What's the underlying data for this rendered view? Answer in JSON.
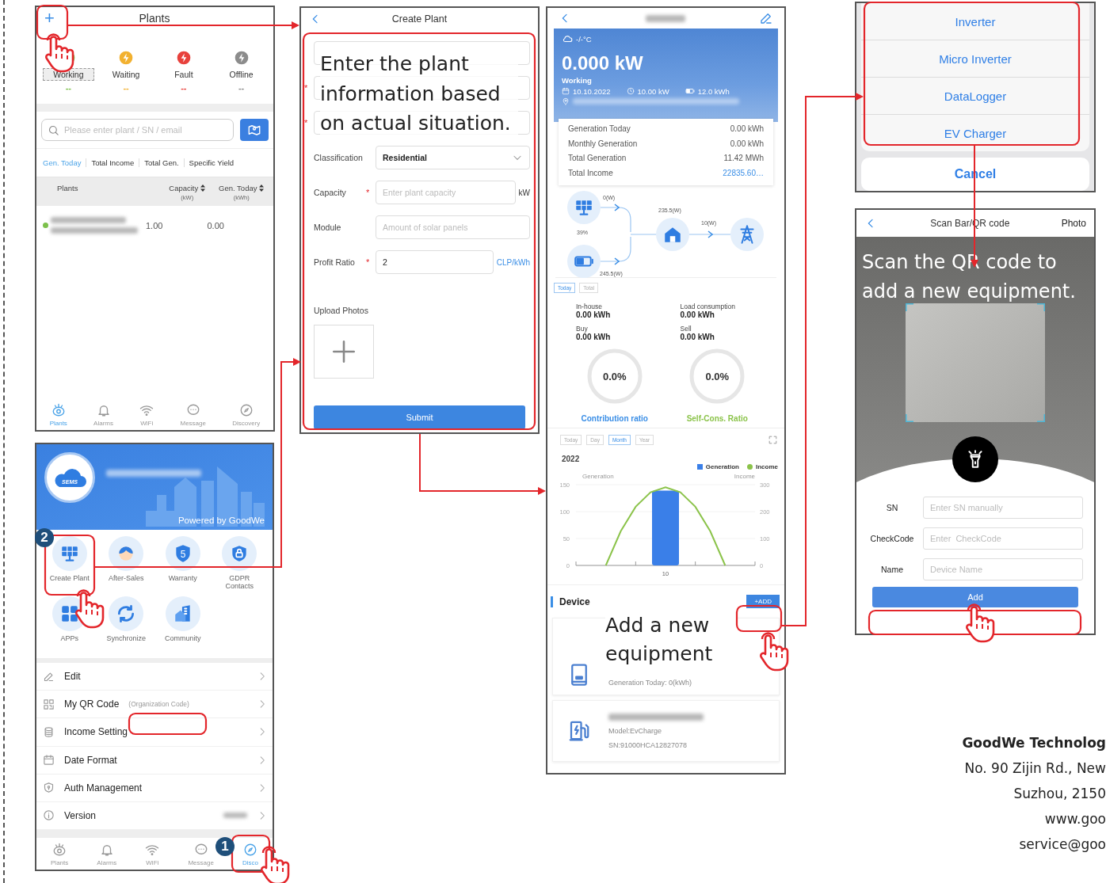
{
  "plants_screen": {
    "add_icon": "+",
    "title": "Plants",
    "status_filters": [
      {
        "label": "Working",
        "count": "--",
        "color": "#7cc04b",
        "selected": true
      },
      {
        "label": "Waiting",
        "count": "--",
        "color": "#f2b130",
        "selected": false
      },
      {
        "label": "Fault",
        "count": "--",
        "color": "#e8413c",
        "selected": false
      },
      {
        "label": "Offline",
        "count": "--",
        "color": "#8c8c8c",
        "selected": false
      }
    ],
    "search": {
      "placeholder": "Please enter plant / SN / email"
    },
    "tabs": [
      {
        "label": "Gen. Today",
        "selected": true
      },
      {
        "label": "Total Income",
        "selected": false
      },
      {
        "label": "Total Gen.",
        "selected": false
      },
      {
        "label": "Specific Yield",
        "selected": false
      }
    ],
    "columns": [
      {
        "label": "Plants"
      },
      {
        "label": "Capacity",
        "unit": "(kW)"
      },
      {
        "label": "Gen. Today",
        "unit": "(kWh)"
      }
    ],
    "rows": [
      {
        "color": "#7cc04b",
        "name_hidden": true,
        "capacity": "1.00",
        "gen_today": "0.00"
      }
    ],
    "nav": [
      {
        "label": "Plants",
        "selected": true
      },
      {
        "label": "Alarms",
        "selected": false
      },
      {
        "label": "WiFi",
        "selected": false
      },
      {
        "label": "Message",
        "selected": false
      },
      {
        "label": "Discovery",
        "selected": false
      }
    ]
  },
  "discovery_screen": {
    "logo_text": "SEMS",
    "email_hidden": true,
    "powered_by": "Powered by GoodWe",
    "services": [
      {
        "label": "Create Plant"
      },
      {
        "label": "After-Sales"
      },
      {
        "label": "Warranty",
        "badge": "5"
      },
      {
        "label": "GDPR Contacts"
      },
      {
        "label": "APPs"
      },
      {
        "label": "Synchronize"
      },
      {
        "label": "Community"
      }
    ],
    "menu": [
      {
        "label": "Edit"
      },
      {
        "label": "My QR Code",
        "note": "(Organization Code)"
      },
      {
        "label": "Income Setting"
      },
      {
        "label": "Date Format"
      },
      {
        "label": "Auth Management"
      },
      {
        "label": "Version",
        "value_hidden": true
      }
    ],
    "nav": [
      {
        "label": "Plants",
        "selected": false
      },
      {
        "label": "Alarms",
        "selected": false
      },
      {
        "label": "WiFi",
        "selected": false
      },
      {
        "label": "Message",
        "selected": false
      },
      {
        "label": "Disco",
        "selected": true
      }
    ],
    "step_badges": [
      "2",
      "1"
    ]
  },
  "create_plant_screen": {
    "title": "Create Plant",
    "required_mark": "*",
    "fields": [
      {
        "kind": "blank",
        "required": false
      },
      {
        "kind": "blank",
        "required": true
      },
      {
        "kind": "blank",
        "required": true
      },
      {
        "kind": "select",
        "label": "Classification",
        "value": "Residential",
        "required": false
      },
      {
        "kind": "input",
        "label": "Capacity",
        "required": true,
        "placeholder": "Enter plant capacity",
        "unit": "kW",
        "unit_selectable": false
      },
      {
        "kind": "input",
        "label": "Module",
        "required": false,
        "placeholder": "Amount of solar panels"
      },
      {
        "kind": "input",
        "label": "Profit Ratio",
        "required": true,
        "value": "2",
        "unit": "CLP/kWh",
        "unit_selectable": true
      }
    ],
    "upload_label": "Upload Photos",
    "submit": "Submit",
    "callout": "Enter the plant information based on actual situation."
  },
  "plant_detail_screen": {
    "title_hidden": true,
    "weather": "-/-°C",
    "power": "0.000 kW",
    "status": "Working",
    "date": "10.10.2022",
    "capacity": "10.00 kW",
    "battery": "12.0 kWh",
    "address_hidden": true,
    "stats": [
      {
        "label": "Generation Today",
        "value": "0.00 kWh",
        "highlight": false
      },
      {
        "label": "Monthly Generation",
        "value": "0.00 kWh",
        "highlight": false
      },
      {
        "label": "Total Generation",
        "value": "11.42 MWh",
        "highlight": false
      },
      {
        "label": "Total Income",
        "value": "22835.60…",
        "highlight": true
      }
    ],
    "flow": {
      "pv": "0(W)",
      "battery_soc": "39%",
      "battery": "245.5(W)",
      "load": "235.5(W)",
      "grid": "10(W)"
    },
    "range_tabs": [
      {
        "label": "Today",
        "selected": true
      },
      {
        "label": "Total",
        "selected": false
      }
    ],
    "energy": [
      {
        "label": "In-house",
        "value": "0.00 kWh"
      },
      {
        "label": "Load consumption",
        "value": "0.00 kWh"
      },
      {
        "label": "Buy",
        "value": "0.00 kWh"
      },
      {
        "label": "Sell",
        "value": "0.00 kWh"
      }
    ],
    "ratios": [
      {
        "value": "0.0%",
        "label": "Contribution ratio",
        "level": 0,
        "color": "#3a8ee6"
      },
      {
        "value": "0.0%",
        "label": "Self-Cons. Ratio",
        "level": 0,
        "color": "#8bc34a"
      }
    ],
    "period_tabs": [
      {
        "label": "Today",
        "selected": false
      },
      {
        "label": "Day",
        "selected": false
      },
      {
        "label": "Month",
        "selected": true
      },
      {
        "label": "Year",
        "selected": false
      }
    ],
    "chart_data": {
      "type": "bar",
      "title": "2022",
      "categories": [
        "10"
      ],
      "ylabel": "Generation",
      "yticks": [
        0,
        50,
        100,
        150
      ],
      "ylim": [
        0,
        150
      ],
      "series": [
        {
          "name": "Generation",
          "color": "#3a7fe8",
          "values": [
            139
          ]
        }
      ]
    },
    "income_chart": {
      "chart_data": {
        "type": "line",
        "ylabel": "Income",
        "categories": [
          null,
          null,
          null,
          null,
          null,
          null,
          null,
          null,
          null
        ],
        "ylim": [
          0,
          300
        ],
        "yticks": [
          0,
          100,
          200,
          300
        ],
        "series": [
          {
            "name": "Income",
            "color": "#8bc34a",
            "values": [
              0,
              127,
              218,
              272,
              290,
              272,
              218,
              127,
              0
            ]
          }
        ]
      }
    },
    "device_title": "Device",
    "add_button": "+ADD",
    "devices": [
      {
        "kind": "inverter",
        "name_hidden": false,
        "lines": [
          "Generation Today: 0(kWh)"
        ]
      },
      {
        "kind": "ev_charger",
        "name_hidden": true,
        "lines": [
          "Model:EvCharge",
          "SN:91000HCA12827078"
        ]
      }
    ],
    "callout": "Add a new equipment"
  },
  "device_type_sheet": {
    "options": [
      "Inverter",
      "Micro Inverter",
      "DataLogger",
      "EV Charger"
    ],
    "cancel": "Cancel"
  },
  "scan_screen": {
    "title": "Scan Bar/QR code",
    "photo": "Photo",
    "callout": "Scan the QR code to add a new equipment.",
    "fields": [
      {
        "label": "SN",
        "placeholder": "Enter SN manually"
      },
      {
        "label": "CheckCode",
        "placeholder": "Enter  CheckCode"
      },
      {
        "label": "Name",
        "placeholder": "Device Name"
      }
    ],
    "submit": "Add"
  },
  "footer": {
    "company": "GoodWe Technolog",
    "address": "No. 90 Zijin Rd., New",
    "city": "Suzhou, 2150",
    "website": "www.goo",
    "email": "service@goo"
  }
}
